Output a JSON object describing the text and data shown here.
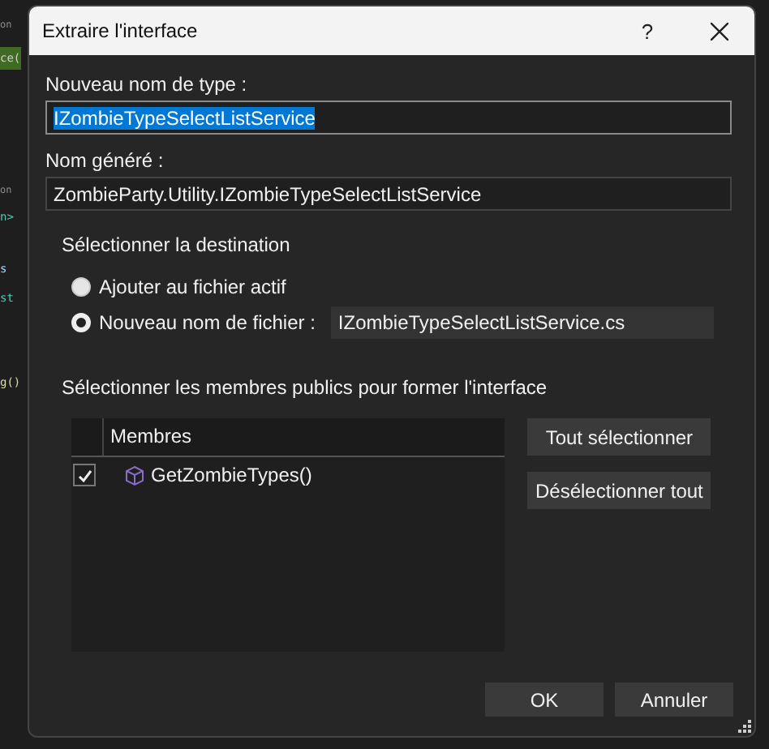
{
  "background_code": [
    {
      "text": "on",
      "kind": "comment"
    },
    {
      "text": "ce(",
      "kind": "highlight"
    },
    {
      "text": "on",
      "kind": "comment"
    },
    {
      "text": "n>",
      "kind": "type"
    },
    {
      "text": "s",
      "kind": "keyword"
    },
    {
      "text": "st",
      "kind": "type"
    },
    {
      "text": "g()",
      "kind": "plain"
    }
  ],
  "window": {
    "title": "Extraire l'interface",
    "help": "?"
  },
  "type_name": {
    "label": "Nouveau nom de type :",
    "value": "IZombieTypeSelectListService"
  },
  "generated_name": {
    "label": "Nom généré :",
    "value": "ZombieParty.Utility.IZombieTypeSelectListService"
  },
  "destination": {
    "title": "Sélectionner la destination",
    "options": [
      {
        "label": "Ajouter au fichier actif",
        "selected": false
      },
      {
        "label": "Nouveau nom de fichier :",
        "selected": true,
        "value": "IZombieTypeSelectListService.cs"
      }
    ]
  },
  "members": {
    "title": "Sélectionner les membres publics pour former l'interface",
    "column": "Membres",
    "rows": [
      {
        "name": "GetZombieTypes()",
        "checked": true
      }
    ],
    "buttons": [
      "Tout sélectionner",
      "Désélectionner tout"
    ]
  },
  "buttons": [
    "OK",
    "Annuler"
  ]
}
